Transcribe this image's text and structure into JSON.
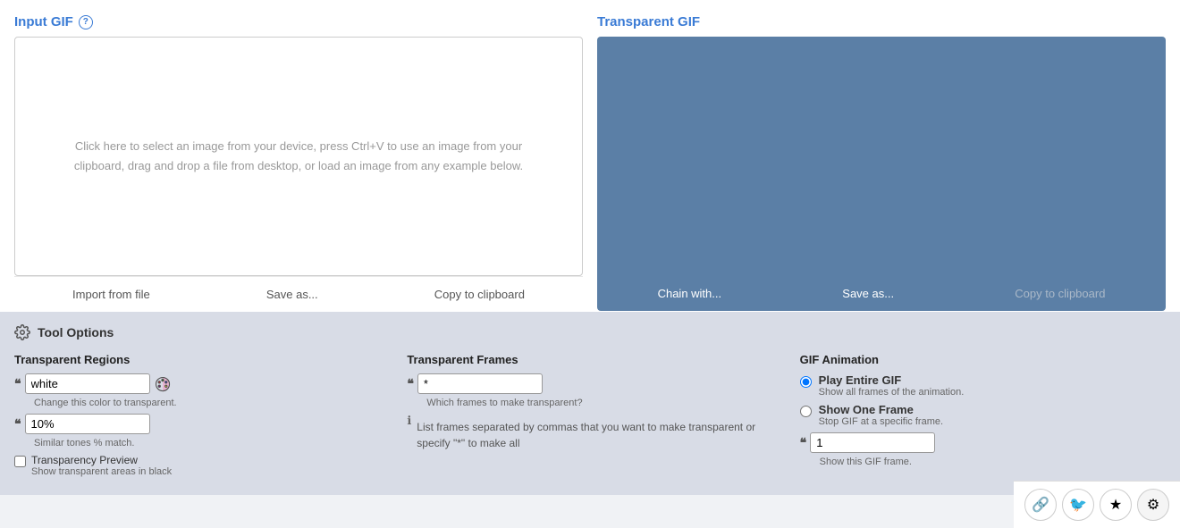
{
  "leftPanel": {
    "title": "Input GIF",
    "helpIcon": "?",
    "dropText": "Click here to select an image from your device, press Ctrl+V to use an image from your clipboard, drag and drop a file from desktop, or load an image from any example below.",
    "actions": [
      {
        "label": "Import from file",
        "name": "import-from-file"
      },
      {
        "label": "Save as...",
        "name": "save-as-left"
      },
      {
        "label": "Copy to clipboard",
        "name": "copy-to-clipboard-left"
      }
    ]
  },
  "rightPanel": {
    "title": "Transparent GIF",
    "actions": [
      {
        "label": "Chain with...",
        "name": "chain-with"
      },
      {
        "label": "Save as...",
        "name": "save-as-right"
      },
      {
        "label": "Copy to clipboard",
        "name": "copy-to-clipboard-right",
        "disabled": true
      }
    ]
  },
  "toolOptions": {
    "title": "Tool Options",
    "sections": {
      "transparentRegions": {
        "title": "Transparent Regions",
        "colorValue": "white",
        "colorHelper": "Change this color to transparent.",
        "percentValue": "10%",
        "percentHelper": "Similar tones % match.",
        "checkboxLabel": "Transparency Preview",
        "checkboxSubLabel": "Show transparent areas in black"
      },
      "transparentFrames": {
        "title": "Transparent Frames",
        "framesValue": "*",
        "framesPlaceholder": "*",
        "framesHelper": "Which frames to make transparent?",
        "description": "List frames separated by commas that you want to make transparent or specify \"*\" to make all"
      },
      "gifAnimation": {
        "title": "GIF Animation",
        "radio1": {
          "label": "Play Entire GIF",
          "sub": "Show all frames of the animation.",
          "checked": true
        },
        "radio2": {
          "label": "Show One Frame",
          "sub": "Stop GIF at a specific frame.",
          "checked": false
        },
        "frameValue": "1",
        "frameHelper": "Show this GIF frame."
      }
    }
  },
  "bottomBar": {
    "icons": [
      {
        "name": "link-icon",
        "symbol": "🔗"
      },
      {
        "name": "twitter-icon",
        "symbol": "🐦"
      },
      {
        "name": "star-icon",
        "symbol": "★"
      },
      {
        "name": "settings-icon",
        "symbol": "⚙"
      }
    ]
  }
}
